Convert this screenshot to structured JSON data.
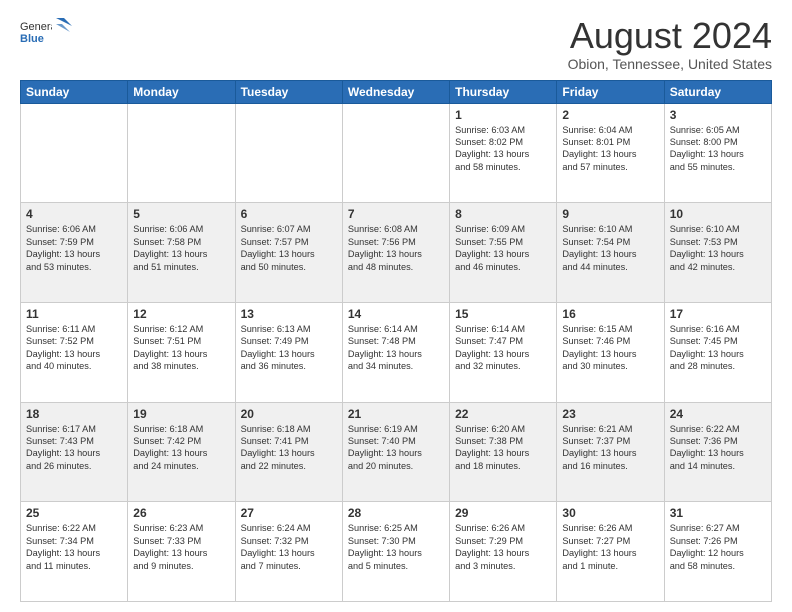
{
  "header": {
    "logo_general": "General",
    "logo_blue": "Blue",
    "title": "August 2024",
    "subtitle": "Obion, Tennessee, United States"
  },
  "days_of_week": [
    "Sunday",
    "Monday",
    "Tuesday",
    "Wednesday",
    "Thursday",
    "Friday",
    "Saturday"
  ],
  "weeks": [
    [
      {
        "day": "",
        "content": ""
      },
      {
        "day": "",
        "content": ""
      },
      {
        "day": "",
        "content": ""
      },
      {
        "day": "",
        "content": ""
      },
      {
        "day": "1",
        "content": "Sunrise: 6:03 AM\nSunset: 8:02 PM\nDaylight: 13 hours\nand 58 minutes."
      },
      {
        "day": "2",
        "content": "Sunrise: 6:04 AM\nSunset: 8:01 PM\nDaylight: 13 hours\nand 57 minutes."
      },
      {
        "day": "3",
        "content": "Sunrise: 6:05 AM\nSunset: 8:00 PM\nDaylight: 13 hours\nand 55 minutes."
      }
    ],
    [
      {
        "day": "4",
        "content": "Sunrise: 6:06 AM\nSunset: 7:59 PM\nDaylight: 13 hours\nand 53 minutes."
      },
      {
        "day": "5",
        "content": "Sunrise: 6:06 AM\nSunset: 7:58 PM\nDaylight: 13 hours\nand 51 minutes."
      },
      {
        "day": "6",
        "content": "Sunrise: 6:07 AM\nSunset: 7:57 PM\nDaylight: 13 hours\nand 50 minutes."
      },
      {
        "day": "7",
        "content": "Sunrise: 6:08 AM\nSunset: 7:56 PM\nDaylight: 13 hours\nand 48 minutes."
      },
      {
        "day": "8",
        "content": "Sunrise: 6:09 AM\nSunset: 7:55 PM\nDaylight: 13 hours\nand 46 minutes."
      },
      {
        "day": "9",
        "content": "Sunrise: 6:10 AM\nSunset: 7:54 PM\nDaylight: 13 hours\nand 44 minutes."
      },
      {
        "day": "10",
        "content": "Sunrise: 6:10 AM\nSunset: 7:53 PM\nDaylight: 13 hours\nand 42 minutes."
      }
    ],
    [
      {
        "day": "11",
        "content": "Sunrise: 6:11 AM\nSunset: 7:52 PM\nDaylight: 13 hours\nand 40 minutes."
      },
      {
        "day": "12",
        "content": "Sunrise: 6:12 AM\nSunset: 7:51 PM\nDaylight: 13 hours\nand 38 minutes."
      },
      {
        "day": "13",
        "content": "Sunrise: 6:13 AM\nSunset: 7:49 PM\nDaylight: 13 hours\nand 36 minutes."
      },
      {
        "day": "14",
        "content": "Sunrise: 6:14 AM\nSunset: 7:48 PM\nDaylight: 13 hours\nand 34 minutes."
      },
      {
        "day": "15",
        "content": "Sunrise: 6:14 AM\nSunset: 7:47 PM\nDaylight: 13 hours\nand 32 minutes."
      },
      {
        "day": "16",
        "content": "Sunrise: 6:15 AM\nSunset: 7:46 PM\nDaylight: 13 hours\nand 30 minutes."
      },
      {
        "day": "17",
        "content": "Sunrise: 6:16 AM\nSunset: 7:45 PM\nDaylight: 13 hours\nand 28 minutes."
      }
    ],
    [
      {
        "day": "18",
        "content": "Sunrise: 6:17 AM\nSunset: 7:43 PM\nDaylight: 13 hours\nand 26 minutes."
      },
      {
        "day": "19",
        "content": "Sunrise: 6:18 AM\nSunset: 7:42 PM\nDaylight: 13 hours\nand 24 minutes."
      },
      {
        "day": "20",
        "content": "Sunrise: 6:18 AM\nSunset: 7:41 PM\nDaylight: 13 hours\nand 22 minutes."
      },
      {
        "day": "21",
        "content": "Sunrise: 6:19 AM\nSunset: 7:40 PM\nDaylight: 13 hours\nand 20 minutes."
      },
      {
        "day": "22",
        "content": "Sunrise: 6:20 AM\nSunset: 7:38 PM\nDaylight: 13 hours\nand 18 minutes."
      },
      {
        "day": "23",
        "content": "Sunrise: 6:21 AM\nSunset: 7:37 PM\nDaylight: 13 hours\nand 16 minutes."
      },
      {
        "day": "24",
        "content": "Sunrise: 6:22 AM\nSunset: 7:36 PM\nDaylight: 13 hours\nand 14 minutes."
      }
    ],
    [
      {
        "day": "25",
        "content": "Sunrise: 6:22 AM\nSunset: 7:34 PM\nDaylight: 13 hours\nand 11 minutes."
      },
      {
        "day": "26",
        "content": "Sunrise: 6:23 AM\nSunset: 7:33 PM\nDaylight: 13 hours\nand 9 minutes."
      },
      {
        "day": "27",
        "content": "Sunrise: 6:24 AM\nSunset: 7:32 PM\nDaylight: 13 hours\nand 7 minutes."
      },
      {
        "day": "28",
        "content": "Sunrise: 6:25 AM\nSunset: 7:30 PM\nDaylight: 13 hours\nand 5 minutes."
      },
      {
        "day": "29",
        "content": "Sunrise: 6:26 AM\nSunset: 7:29 PM\nDaylight: 13 hours\nand 3 minutes."
      },
      {
        "day": "30",
        "content": "Sunrise: 6:26 AM\nSunset: 7:27 PM\nDaylight: 13 hours\nand 1 minute."
      },
      {
        "day": "31",
        "content": "Sunrise: 6:27 AM\nSunset: 7:26 PM\nDaylight: 12 hours\nand 58 minutes."
      }
    ]
  ]
}
